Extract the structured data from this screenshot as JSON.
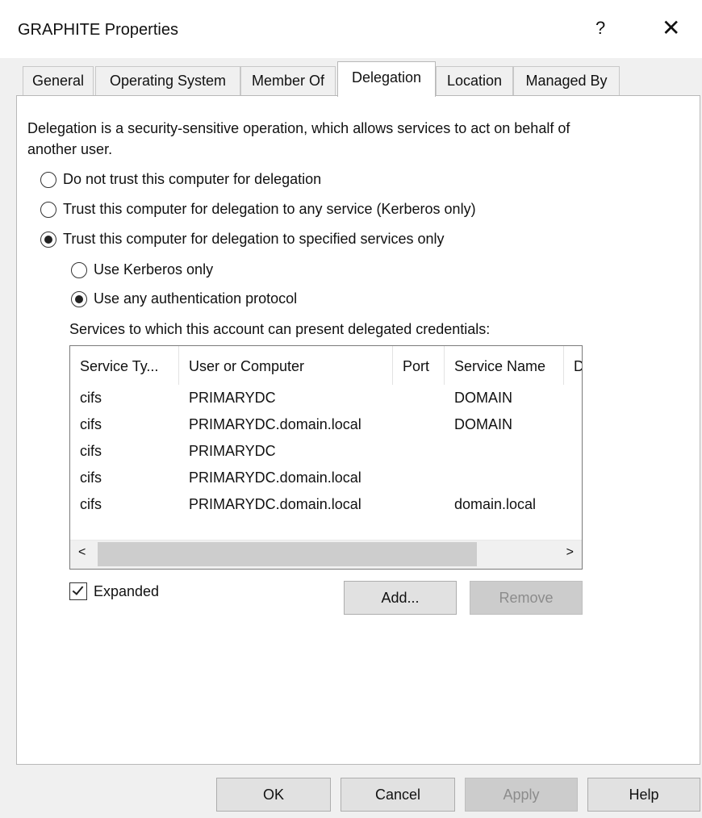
{
  "window": {
    "title": "GRAPHITE Properties",
    "help_glyph": "?",
    "close_glyph": "✕"
  },
  "tabs": [
    {
      "label": "General",
      "active": false
    },
    {
      "label": "Operating System",
      "active": false
    },
    {
      "label": "Member Of",
      "active": false
    },
    {
      "label": "Delegation",
      "active": true
    },
    {
      "label": "Location",
      "active": false
    },
    {
      "label": "Managed By",
      "active": false
    }
  ],
  "delegation": {
    "description": "Delegation is a security-sensitive operation, which allows services to act on behalf of another user.",
    "options": [
      {
        "label": "Do not trust this computer for delegation",
        "checked": false
      },
      {
        "label": "Trust this computer for delegation to any service (Kerberos only)",
        "checked": false
      },
      {
        "label": "Trust this computer for delegation to specified services only",
        "checked": true
      }
    ],
    "sub_options": [
      {
        "label": "Use Kerberos only",
        "checked": false
      },
      {
        "label": "Use any authentication protocol",
        "checked": true
      }
    ],
    "list_caption": "Services to which this account can present delegated credentials:",
    "columns": [
      "Service Ty...",
      "User or Computer",
      "Port",
      "Service Name",
      "D"
    ],
    "rows": [
      [
        "cifs",
        "PRIMARYDC",
        "",
        "DOMAIN"
      ],
      [
        "cifs",
        "PRIMARYDC.domain.local",
        "",
        "DOMAIN"
      ],
      [
        "cifs",
        "PRIMARYDC",
        "",
        ""
      ],
      [
        "cifs",
        "PRIMARYDC.domain.local",
        "",
        ""
      ],
      [
        "cifs",
        "PRIMARYDC.domain.local",
        "",
        "domain.local"
      ]
    ],
    "scroll_left": "<",
    "scroll_right": ">",
    "expanded_label": "Expanded",
    "expanded_checked": true,
    "add_label": "Add...",
    "remove_label": "Remove"
  },
  "footer": {
    "ok": "OK",
    "cancel": "Cancel",
    "apply": "Apply",
    "help": "Help"
  }
}
